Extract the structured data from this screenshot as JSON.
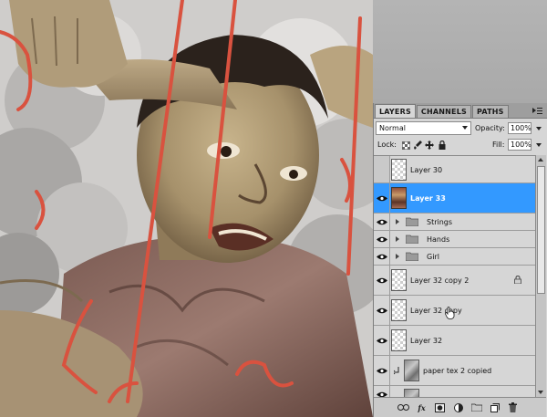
{
  "panel": {
    "tabs": [
      {
        "label": "LAYERS",
        "active": true
      },
      {
        "label": "CHANNELS",
        "active": false
      },
      {
        "label": "PATHS",
        "active": false
      }
    ],
    "blend_mode": "Normal",
    "opacity_label": "Opacity:",
    "opacity_value": "100%",
    "lock_label": "Lock:",
    "fill_label": "Fill:",
    "fill_value": "100%"
  },
  "layers": [
    {
      "name": "Layer 30",
      "visible": false,
      "selected": false,
      "kind": "layer",
      "thumb": "transparent"
    },
    {
      "name": "Layer 33",
      "visible": true,
      "selected": true,
      "kind": "layer",
      "thumb": "art"
    },
    {
      "name": "Strings",
      "visible": true,
      "selected": false,
      "kind": "group"
    },
    {
      "name": "Hands",
      "visible": true,
      "selected": false,
      "kind": "group"
    },
    {
      "name": "Girl",
      "visible": true,
      "selected": false,
      "kind": "group"
    },
    {
      "name": "Layer 32 copy 2",
      "visible": true,
      "selected": false,
      "kind": "layer",
      "thumb": "transparent",
      "locked": true
    },
    {
      "name": "Layer 32 copy",
      "visible": true,
      "selected": false,
      "kind": "layer",
      "thumb": "transparent"
    },
    {
      "name": "Layer 32",
      "visible": true,
      "selected": false,
      "kind": "layer",
      "thumb": "transparent"
    },
    {
      "name": "paper tex 2 copied",
      "visible": true,
      "selected": false,
      "kind": "clipped",
      "thumb": "texture"
    }
  ],
  "icons": {
    "eye": "eye-icon",
    "lock_transparent": "checkerboard-lock-icon",
    "lock_image": "brush-lock-icon",
    "lock_position": "move-lock-icon",
    "lock_all": "padlock-icon",
    "link": "link-icon",
    "fx": "fx-icon",
    "mask": "mask-icon",
    "adjustment": "adjustment-icon",
    "group": "new-group-icon",
    "new_layer": "new-layer-icon",
    "trash": "trash-icon"
  },
  "colors": {
    "selection": "#3399ff",
    "panel_bg": "#d6d6d6",
    "string_red": "#d9523f"
  }
}
